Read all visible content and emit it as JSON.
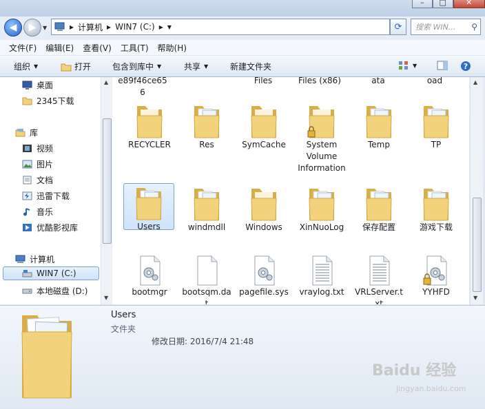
{
  "window": {
    "controls": [
      "–",
      "□",
      "✕"
    ]
  },
  "address": {
    "segments": [
      "计算机",
      "WIN7 (C:)"
    ]
  },
  "search": {
    "placeholder": "搜索 WIN..."
  },
  "menu": [
    "文件(F)",
    "编辑(E)",
    "查看(V)",
    "工具(T)",
    "帮助(H)"
  ],
  "toolbar": {
    "organize": "组织",
    "open": "打开",
    "include": "包含到库中",
    "share": "共享",
    "new_folder": "新建文件夹"
  },
  "sidebar": {
    "items": [
      {
        "label": "桌面",
        "icon": "desktop-icon"
      },
      {
        "label": "2345下载",
        "icon": "folder-icon"
      },
      {
        "label": "库",
        "icon": "library-icon"
      },
      {
        "label": "视频",
        "icon": "video-icon"
      },
      {
        "label": "图片",
        "icon": "picture-icon"
      },
      {
        "label": "文档",
        "icon": "document-icon"
      },
      {
        "label": "迅雷下载",
        "icon": "thunder-icon"
      },
      {
        "label": "音乐",
        "icon": "music-icon"
      },
      {
        "label": "优酷影视库",
        "icon": "youku-icon"
      },
      {
        "label": "计算机",
        "icon": "computer-icon"
      },
      {
        "label": "WIN7 (C:)",
        "icon": "drive-icon"
      },
      {
        "label": "本地磁盘 (D:)",
        "icon": "drive-icon"
      }
    ]
  },
  "files": {
    "row0": [
      "e89f46ce656",
      "Files",
      "Files (x86)",
      "ata",
      "oad"
    ],
    "row1": [
      {
        "name": "RECYCLER",
        "type": "folder"
      },
      {
        "name": "Res",
        "type": "folder-docs"
      },
      {
        "name": "SymCache",
        "type": "folder"
      },
      {
        "name": "System Volume Information",
        "type": "folder-locked"
      },
      {
        "name": "Temp",
        "type": "folder-docs"
      },
      {
        "name": "TP",
        "type": "folder-docs"
      }
    ],
    "row2": [
      {
        "name": "Users",
        "type": "folder-docs"
      },
      {
        "name": "windmdll",
        "type": "folder-docs"
      },
      {
        "name": "Windows",
        "type": "folder"
      },
      {
        "name": "XinNuoLog",
        "type": "folder-docs"
      },
      {
        "name": "保存配置",
        "type": "folder-docs"
      },
      {
        "name": "游戏下载",
        "type": "folder-docs"
      }
    ],
    "row3": [
      {
        "name": "bootmgr",
        "type": "sysfile"
      },
      {
        "name": "bootsqm.dat",
        "type": "blank"
      },
      {
        "name": "pagefile.sys",
        "type": "sysfile"
      },
      {
        "name": "vraylog.txt",
        "type": "text"
      },
      {
        "name": "VRLServer.txt",
        "type": "text"
      },
      {
        "name": "YYHFD",
        "type": "sysfile-locked"
      }
    ]
  },
  "details": {
    "name": "Users",
    "type": "文件夹",
    "modified": "修改日期: 2016/7/4 21:48"
  },
  "watermark": {
    "brand": "Baidu 经验",
    "url": "jingyan.baidu.com"
  },
  "colors": {
    "folder": "#f2d27a",
    "folder_dark": "#d9ad48",
    "selection": "#cfe3fb",
    "link_blue": "#2563c9"
  }
}
